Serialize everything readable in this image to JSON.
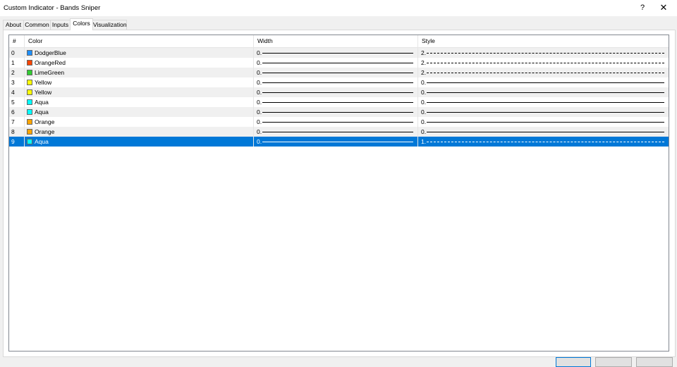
{
  "window": {
    "title": "Custom Indicator - Bands Sniper",
    "help": "?",
    "close": "✕"
  },
  "tabs": [
    "About",
    "Common",
    "Inputs",
    "Colors",
    "Visualization"
  ],
  "active_tab": "Colors",
  "table": {
    "headers": [
      "#",
      "Color",
      "Width",
      "Style"
    ],
    "rows": [
      {
        "num": "0",
        "color": "DodgerBlue",
        "swatch": "#1e90ff",
        "width": "0.",
        "style": "2."
      },
      {
        "num": "1",
        "color": "OrangeRed",
        "swatch": "#ff4500",
        "width": "0.",
        "style": "2."
      },
      {
        "num": "2",
        "color": "LimeGreen",
        "swatch": "#32cd32",
        "width": "0.",
        "style": "2."
      },
      {
        "num": "3",
        "color": "Yellow",
        "swatch": "#ffff00",
        "width": "0.",
        "style": "0."
      },
      {
        "num": "4",
        "color": "Yellow",
        "swatch": "#ffff00",
        "width": "0.",
        "style": "0."
      },
      {
        "num": "5",
        "color": "Aqua",
        "swatch": "#00ffff",
        "width": "0.",
        "style": "0."
      },
      {
        "num": "6",
        "color": "Aqua",
        "swatch": "#00ffff",
        "width": "0.",
        "style": "0."
      },
      {
        "num": "7",
        "color": "Orange",
        "swatch": "#ffa500",
        "width": "0.",
        "style": "0."
      },
      {
        "num": "8",
        "color": "Orange",
        "swatch": "#ffa500",
        "width": "0.",
        "style": "0."
      },
      {
        "num": "9",
        "color": "Aqua",
        "swatch": "#00ffff",
        "width": "0.",
        "style": "1."
      }
    ],
    "selected_row": 9
  },
  "colors": {
    "selection": "#0078d7",
    "border": "#828790"
  }
}
